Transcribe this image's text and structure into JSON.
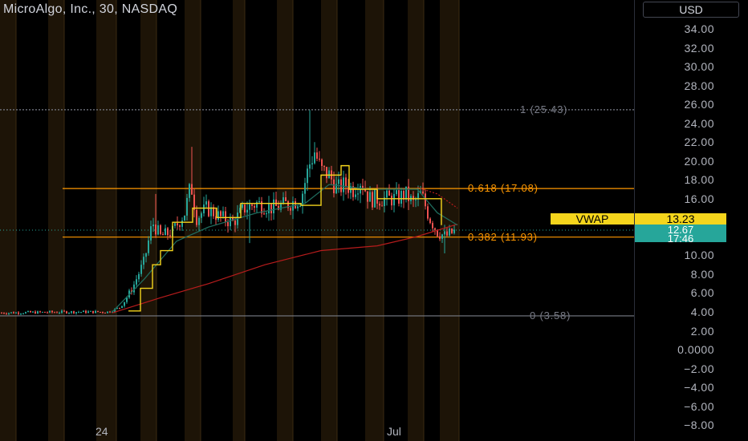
{
  "symbol": {
    "title": "MicroAlgo, Inc., 30, NASDAQ"
  },
  "currency": "USD",
  "price_axis": {
    "ticks": [
      {
        "label": "34.00",
        "value": 34
      },
      {
        "label": "32.00",
        "value": 32
      },
      {
        "label": "30.00",
        "value": 30
      },
      {
        "label": "28.00",
        "value": 28
      },
      {
        "label": "26.00",
        "value": 26
      },
      {
        "label": "24.00",
        "value": 24
      },
      {
        "label": "22.00",
        "value": 22
      },
      {
        "label": "20.00",
        "value": 20
      },
      {
        "label": "18.00",
        "value": 18
      },
      {
        "label": "16.00",
        "value": 16
      },
      {
        "label": "10.00",
        "value": 10
      },
      {
        "label": "8.00",
        "value": 8
      },
      {
        "label": "6.00",
        "value": 6
      },
      {
        "label": "4.00",
        "value": 4
      },
      {
        "label": "2.00",
        "value": 2
      },
      {
        "label": "0.0000",
        "value": 0
      },
      {
        "label": "−2.00",
        "value": -2
      },
      {
        "label": "−4.00",
        "value": -4
      },
      {
        "label": "−6.00",
        "value": -6
      },
      {
        "label": "−8.00",
        "value": -8
      }
    ],
    "vwap_label": "VWAP",
    "vwap_value": "13.23",
    "last_price": "12.67",
    "countdown": "17:46"
  },
  "time_axis": {
    "labels": [
      {
        "label": "24"
      },
      {
        "label": "Jul"
      }
    ]
  },
  "fib_levels": [
    {
      "label": "1 (25.43)",
      "value": 25.43,
      "color": "#787b86"
    },
    {
      "label": "0.618 (17.08)",
      "value": 17.08,
      "color": "#ff9800"
    },
    {
      "label": "0.382 (11.93)",
      "value": 11.93,
      "color": "#ff9800"
    },
    {
      "label": "0 (3.58)",
      "value": 3.58,
      "color": "#787b86"
    }
  ],
  "colors": {
    "up": "#26a69a",
    "down": "#ef5350",
    "vwap": "#f5d51c",
    "fib_mid": "#ff9800",
    "fib_edge": "#b2b5be",
    "session_bg": "#1d1407",
    "ma_long": "#b71c1c",
    "ma_short": "#1f6b5c"
  },
  "chart_data": {
    "type": "candlestick",
    "anchors": [
      [
        0,
        3.9
      ],
      [
        90,
        4.0
      ],
      [
        135,
        4.0
      ],
      [
        150,
        4.5
      ],
      [
        165,
        6.5
      ],
      [
        180,
        9.5
      ],
      [
        190,
        13.5
      ],
      [
        200,
        12.0
      ],
      [
        215,
        12.5
      ],
      [
        230,
        14.5
      ],
      [
        238,
        17.5
      ],
      [
        245,
        14.0
      ],
      [
        258,
        15.0
      ],
      [
        275,
        14.0
      ],
      [
        290,
        13.5
      ],
      [
        305,
        15.0
      ],
      [
        320,
        15.5
      ],
      [
        340,
        15.0
      ],
      [
        360,
        15.5
      ],
      [
        375,
        16.0
      ],
      [
        385,
        19.5
      ],
      [
        392,
        21.0
      ],
      [
        400,
        19.0
      ],
      [
        410,
        18.5
      ],
      [
        420,
        17.0
      ],
      [
        430,
        17.5
      ],
      [
        440,
        17.0
      ],
      [
        450,
        18.0
      ],
      [
        460,
        16.0
      ],
      [
        475,
        16.0
      ],
      [
        495,
        16.0
      ],
      [
        505,
        16.5
      ],
      [
        515,
        15.5
      ],
      [
        525,
        16.5
      ],
      [
        535,
        14.0
      ],
      [
        545,
        12.5
      ],
      [
        555,
        12.0
      ],
      [
        568,
        12.6
      ]
    ],
    "spikes": [
      [
        238,
        21.5
      ],
      [
        193,
        16.5
      ],
      [
        385,
        25.4
      ],
      [
        555,
        10.2
      ],
      [
        310,
        11.3
      ]
    ],
    "vwap_line": [
      [
        160,
        4.1
      ],
      [
        175,
        6.5
      ],
      [
        190,
        9.0
      ],
      [
        200,
        10.5
      ],
      [
        215,
        13.5
      ],
      [
        240,
        15.0
      ],
      [
        270,
        14.0
      ],
      [
        300,
        15.5
      ],
      [
        340,
        15.5
      ],
      [
        375,
        15.3
      ],
      [
        400,
        18.5
      ],
      [
        425,
        19.5
      ],
      [
        435,
        17.0
      ],
      [
        470,
        16.0
      ],
      [
        520,
        16.0
      ],
      [
        550,
        13.2
      ]
    ],
    "ma_short": [
      [
        140,
        4.0
      ],
      [
        180,
        7.5
      ],
      [
        220,
        11.5
      ],
      [
        260,
        13.0
      ],
      [
        320,
        14.5
      ],
      [
        380,
        15.5
      ],
      [
        410,
        17.5
      ],
      [
        460,
        17.0
      ],
      [
        520,
        17.0
      ],
      [
        545,
        14.5
      ],
      [
        570,
        13.2
      ]
    ],
    "ma_long": [
      [
        140,
        3.9
      ],
      [
        200,
        5.5
      ],
      [
        260,
        7.0
      ],
      [
        330,
        9.0
      ],
      [
        400,
        10.5
      ],
      [
        470,
        11.0
      ],
      [
        520,
        12.0
      ],
      [
        570,
        13.3
      ]
    ],
    "ma_dotted": [
      [
        520,
        17.2
      ],
      [
        545,
        16.5
      ],
      [
        570,
        15.0
      ]
    ],
    "y_range": [
      -9,
      36.5
    ]
  }
}
